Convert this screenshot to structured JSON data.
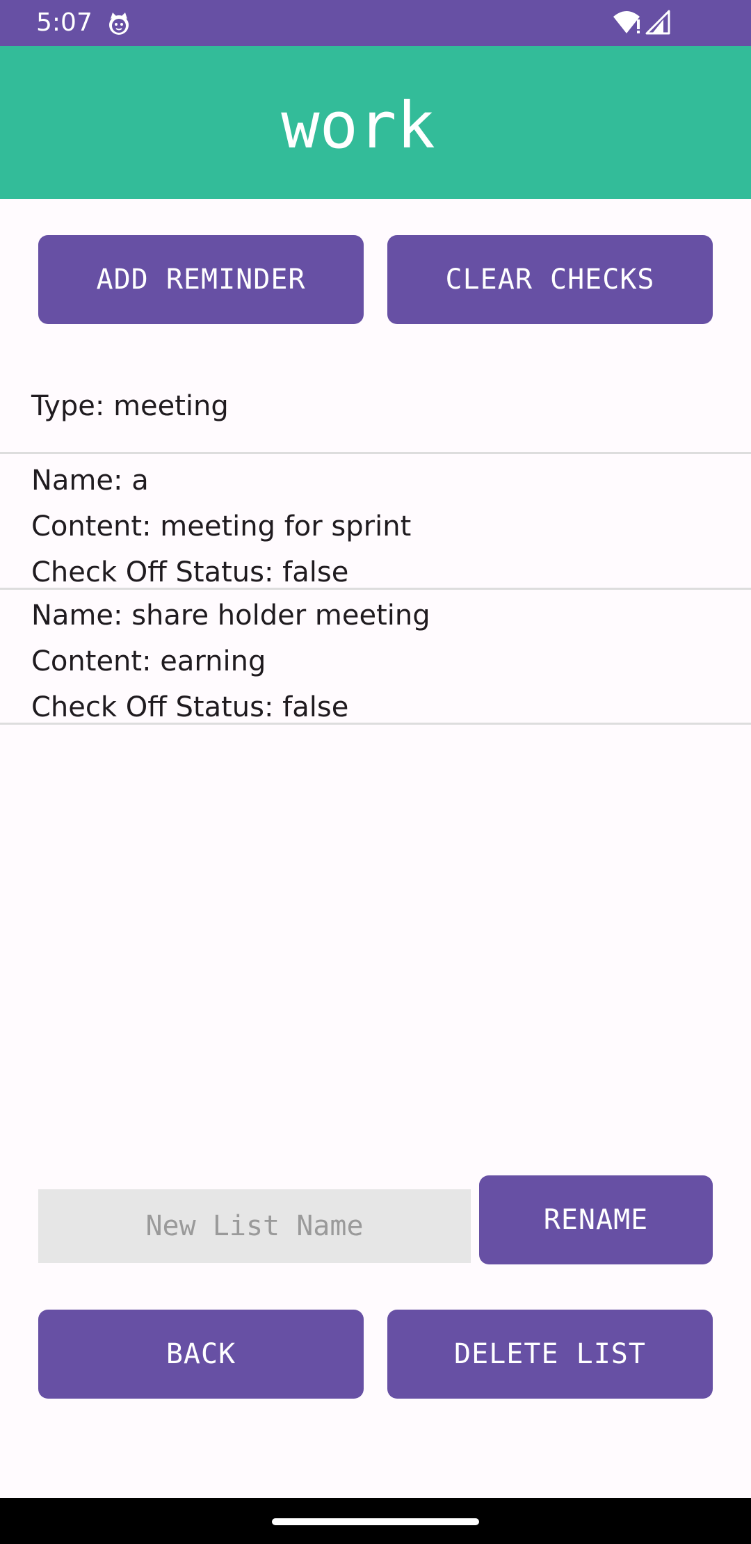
{
  "status_bar": {
    "time": "5:07",
    "icons": [
      "cat-notification-icon",
      "wifi-icon",
      "signal-icon"
    ]
  },
  "app_bar": {
    "title": "work"
  },
  "buttons": {
    "add_reminder": "ADD REMINDER",
    "clear_checks": "CLEAR CHECKS",
    "rename": "RENAME",
    "back": "BACK",
    "delete_list": "DELETE LIST"
  },
  "list": {
    "type_label": "Type: meeting",
    "items": [
      {
        "name": "Name: a",
        "content": "Content: meeting for sprint",
        "status": "Check Off Status: false"
      },
      {
        "name": "Name: share holder meeting",
        "content": "Content: earning",
        "status": "Check Off Status: false"
      }
    ]
  },
  "rename_field": {
    "value": "",
    "placeholder": "New List Name"
  },
  "colors": {
    "status_bar": "#6750a4",
    "app_bar": "#33bc99",
    "button": "#6750a4",
    "background": "#fffbfe"
  }
}
